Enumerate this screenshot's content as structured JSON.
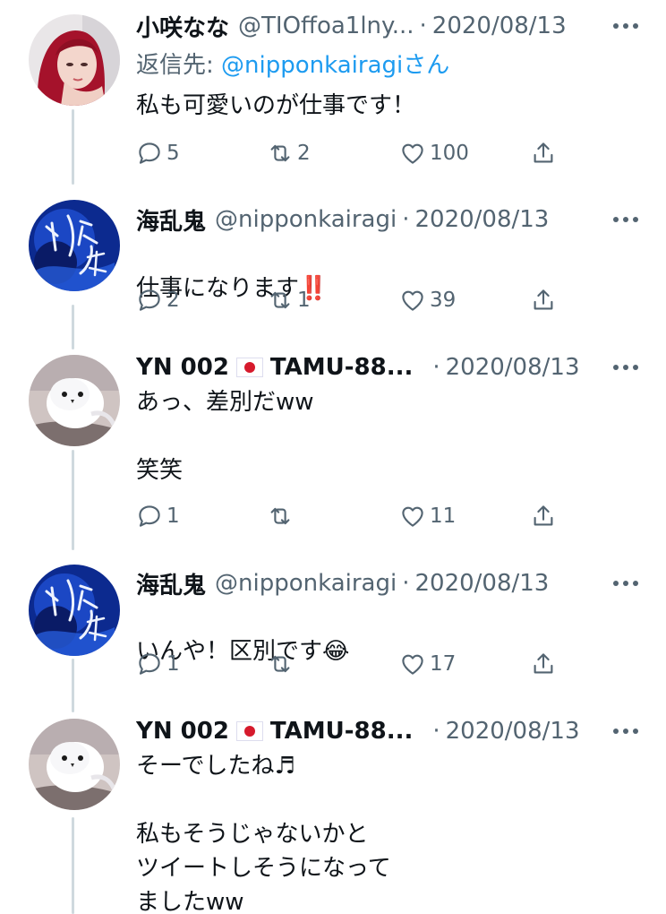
{
  "tweets": [
    {
      "name": "小咲なな",
      "handle": "@TIOffoa1lny...",
      "dot": "·",
      "date": "2020/08/13",
      "reply_prefix": "返信先: ",
      "reply_mention": "@nipponkairagiさん",
      "text": "私も可愛いのが仕事です！",
      "replies": "5",
      "retweets": "2",
      "likes": "100",
      "avatar": "woman-red-hair-avatar"
    },
    {
      "name": "海乱鬼",
      "handle": "@nipponkairagi",
      "dot": "·",
      "date": "2020/08/13",
      "text": "仕事になります",
      "emoji": "‼️",
      "replies": "2",
      "retweets": "1",
      "likes": "39",
      "avatar": "blue-calligraphy-avatar"
    },
    {
      "name": "YN 002",
      "name_rest": "TAMU-88...",
      "dot": "·",
      "date": "2020/08/13",
      "text": "あっ、差別だww\n\n笑笑",
      "replies": "1",
      "retweets": "",
      "likes": "11",
      "avatar": "white-bird-avatar"
    },
    {
      "name": "海乱鬼",
      "handle": "@nipponkairagi",
      "dot": "·",
      "date": "2020/08/13",
      "text": "いんや！区別です",
      "emoji": "😂",
      "replies": "1",
      "retweets": "",
      "likes": "17",
      "avatar": "blue-calligraphy-avatar"
    },
    {
      "name": "YN 002",
      "name_rest": "TAMU-88...",
      "dot": "·",
      "date": "2020/08/13",
      "text": "そーでしたね♬\n\n私もそうじゃないかと\nツイートしそうになって\nましたww",
      "avatar": "white-bird-avatar"
    }
  ],
  "colors": {
    "text": "#0f1419",
    "muted": "#536471",
    "link": "#1d9bf0",
    "thread": "#cfd9de"
  },
  "icons": [
    "reply-icon",
    "retweet-icon",
    "like-icon",
    "share-icon",
    "more-icon",
    "japan-flag-icon"
  ]
}
